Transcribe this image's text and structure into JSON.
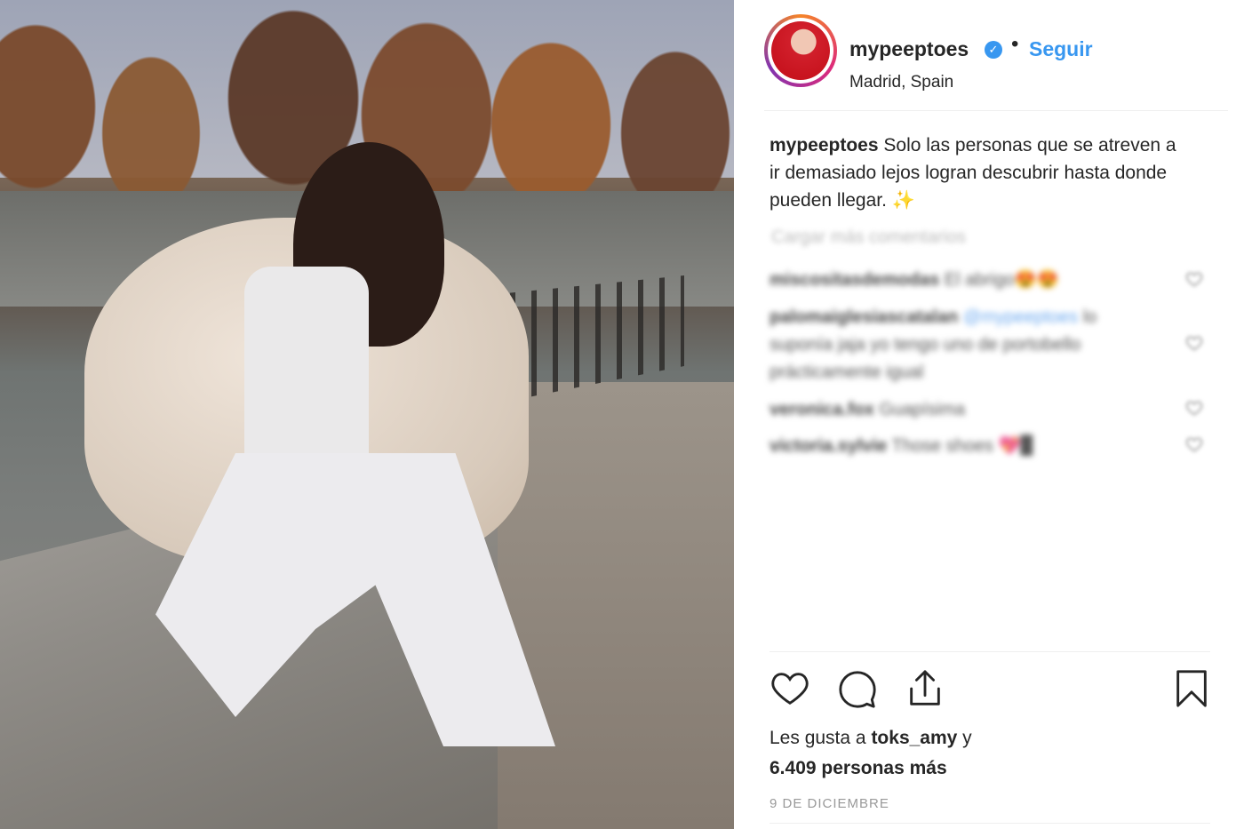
{
  "header": {
    "username": "mypeeptoes",
    "verified_icon": "verified-badge-icon",
    "separator": "•",
    "follow_label": "Seguir",
    "location": "Madrid, Spain"
  },
  "caption": {
    "username": "mypeeptoes",
    "text": "Solo las personas que se atreven a ir demasiado lejos logran descubrir hasta donde pueden llegar. ✨"
  },
  "comments": {
    "load_more": "Cargar más comentarios",
    "items": [
      {
        "user": "miscositasdemodas",
        "text": "El abrigo😍😍"
      },
      {
        "user": "palomaiglesiascatalan",
        "mention": "@mypeeptoes",
        "text": "lo suponía jaja yo tengo uno de portobello prácticamente igual"
      },
      {
        "user": "veronica.fox",
        "text": "Guapísima"
      },
      {
        "user": "victoria.sylvie",
        "text": "Those shoes 💖▉"
      }
    ]
  },
  "likes": {
    "prefix": "Les gusta a",
    "user": "toks_amy",
    "conj": "y",
    "count": "6.409 personas más"
  },
  "date": "9 DE DICIEMBRE",
  "colors": {
    "link": "#3897f0",
    "text": "#262626",
    "muted": "#999999"
  }
}
